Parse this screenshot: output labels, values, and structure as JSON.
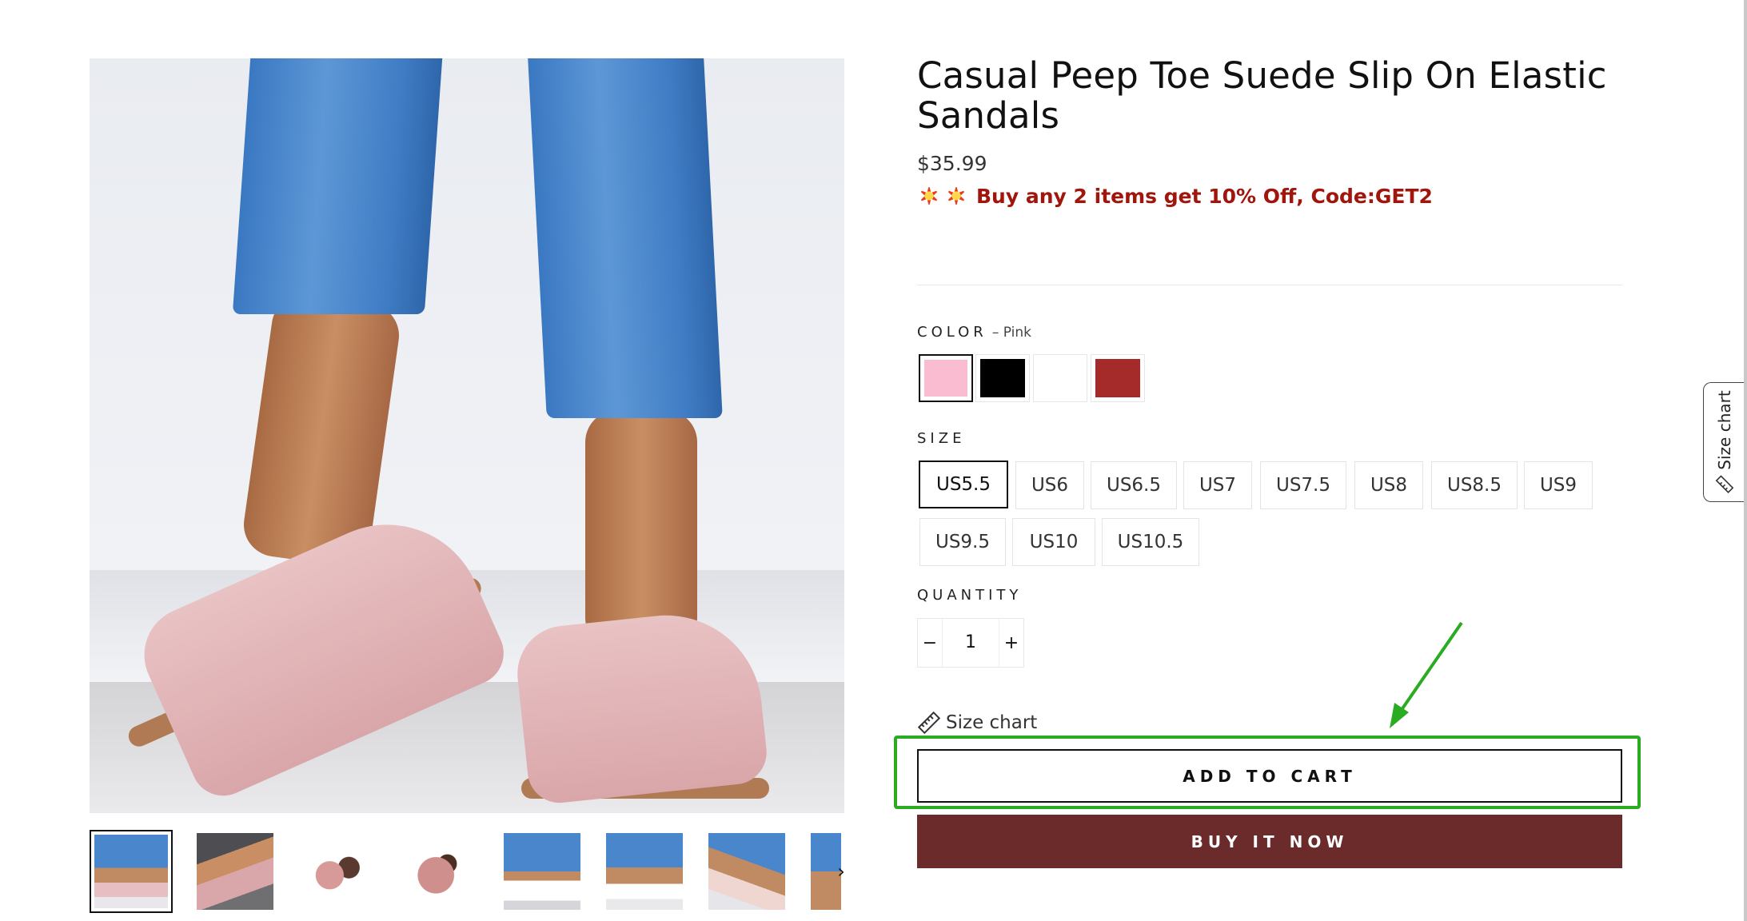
{
  "product": {
    "title": "Casual Peep Toe Suede Slip On Elastic Sandals",
    "price": "$35.99",
    "promo": "Buy any 2 items get 10% Off, Code:GET2",
    "promo_icons": [
      "collision-icon",
      "collision-icon"
    ]
  },
  "color": {
    "label": "COLOR",
    "selected": "– Pink",
    "swatches": [
      {
        "name": "Pink",
        "hex": "#f9bcd0"
      },
      {
        "name": "Black",
        "hex": "#000000"
      },
      {
        "name": "White",
        "hex": "#ffffff"
      },
      {
        "name": "Red",
        "hex": "#a52a2a"
      }
    ]
  },
  "size": {
    "label": "SIZE",
    "options": [
      "US5.5",
      "US6",
      "US6.5",
      "US7",
      "US7.5",
      "US8",
      "US8.5",
      "US9",
      "US9.5",
      "US10",
      "US10.5"
    ],
    "selected": "US5.5"
  },
  "quantity": {
    "label": "QUANTITY",
    "minus": "−",
    "value": "1",
    "plus": "+"
  },
  "size_chart": {
    "link_label": "Size chart",
    "side_tab_label": "Size chart"
  },
  "actions": {
    "add_to_cart": "ADD TO CART",
    "buy_now": "BUY IT NOW"
  },
  "gallery": {
    "next_icon": "chevron-right-icon",
    "next_glyph": "›",
    "thumbnail_count": 8
  },
  "colors": {
    "promo_red": "#a0150c",
    "buy_now_bg": "#6b2b2b",
    "highlight_green": "#2bab22"
  }
}
